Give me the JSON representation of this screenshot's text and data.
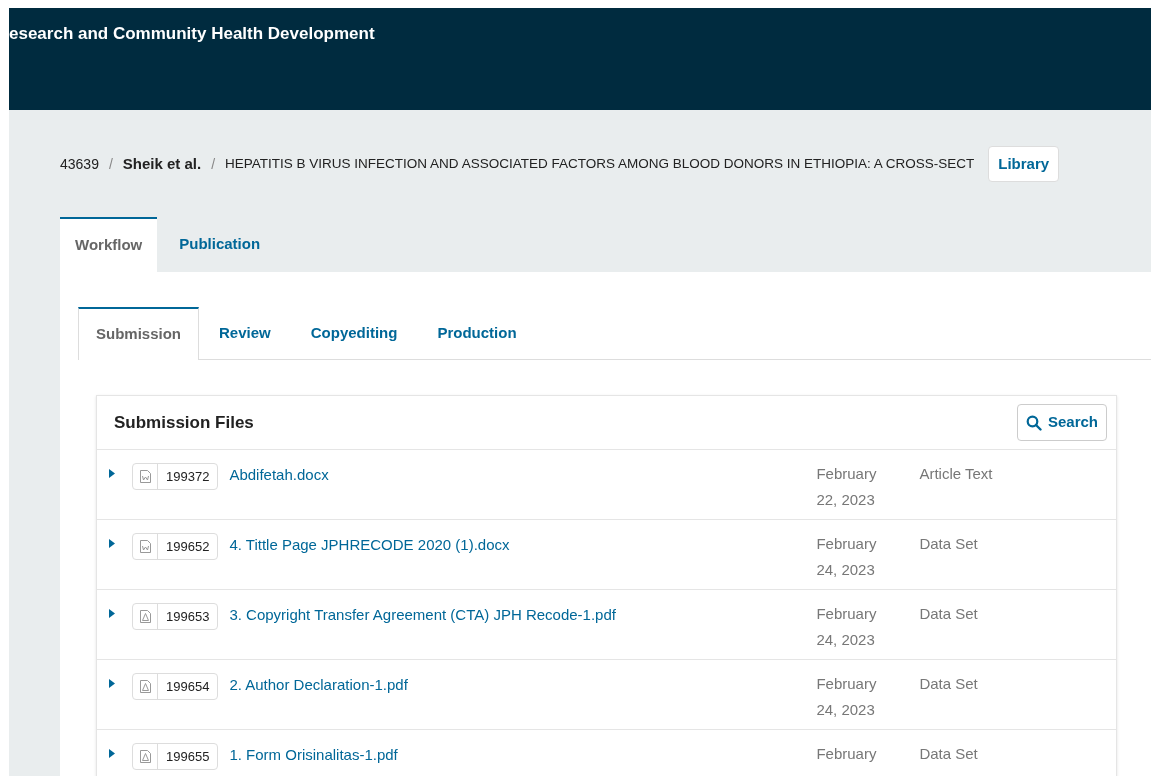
{
  "header": {
    "title": "esearch and Community Health Development"
  },
  "breadcrumb": {
    "id": "43639",
    "separators": [
      "/",
      "/"
    ],
    "authors": "Sheik et al.",
    "title": "HEPATITIS B VIRUS INFECTION AND ASSOCIATED FACTORS AMONG BLOOD DONORS IN ETHIOPIA: A CROSS-SECT"
  },
  "library_button": "Library",
  "tabs": [
    {
      "label": "Workflow",
      "selected": true
    },
    {
      "label": "Publication",
      "selected": false
    }
  ],
  "subtabs": [
    {
      "label": "Submission",
      "selected": true
    },
    {
      "label": "Review",
      "selected": false
    },
    {
      "label": "Copyediting",
      "selected": false
    },
    {
      "label": "Production",
      "selected": false
    }
  ],
  "files_panel": {
    "title": "Submission Files",
    "search_button": "Search",
    "files": [
      {
        "kind": "word",
        "id": "199372",
        "name": "Abdifetah.docx",
        "date": "February 22, 2023",
        "type": "Article Text",
        "expanded": false
      },
      {
        "kind": "word",
        "id": "199652",
        "name": "4. Tittle Page JPHRECODE 2020 (1).docx",
        "date": "February 24, 2023",
        "type": "Data Set",
        "expanded": false
      },
      {
        "kind": "pdf",
        "id": "199653",
        "name": "3. Copyright Transfer Agreement (CTA) JPH Recode-1.pdf",
        "date": "February 24, 2023",
        "type": "Data Set",
        "expanded": false
      },
      {
        "kind": "pdf",
        "id": "199654",
        "name": "2. Author Declaration-1.pdf",
        "date": "February 24, 2023",
        "type": "Data Set",
        "expanded": false
      },
      {
        "kind": "pdf",
        "id": "199655",
        "name": "1. Form Orisinalitas-1.pdf",
        "date": "February",
        "type": "Data Set",
        "expanded": false
      }
    ]
  }
}
